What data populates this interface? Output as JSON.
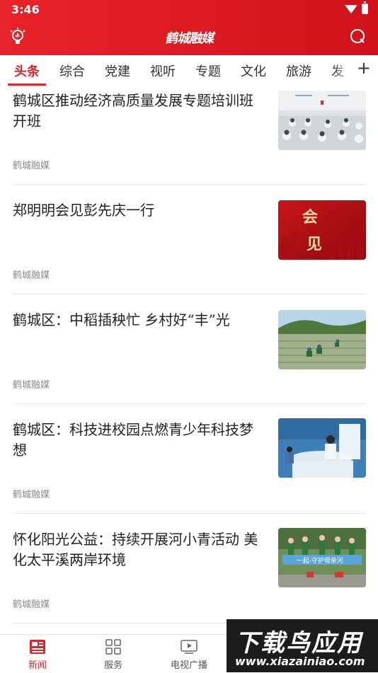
{
  "status": {
    "time": "3:46"
  },
  "app": {
    "title": "鹤城融媒"
  },
  "tabs": [
    "头条",
    "综合",
    "党建",
    "视听",
    "专题",
    "文化",
    "旅游",
    "发"
  ],
  "tabs_more": "+",
  "news": [
    {
      "title": "鹤城区推动经济高质量发展专题培训班开班",
      "source": "鹤城融媒"
    },
    {
      "title": "郑明明会见彭先庆一行",
      "source": "鹤城融媒",
      "badge": [
        "会",
        "见"
      ]
    },
    {
      "title": "鹤城区：中稻插秧忙 乡村好“丰”光",
      "source": "鹤城融媒"
    },
    {
      "title": "鹤城区：科技进校园点燃青少年科技梦想",
      "source": "鹤城融媒"
    },
    {
      "title": "怀化阳光公益：持续开展河小青活动 美化太平溪两岸环境",
      "source": "鹤城融媒",
      "banner": "一起·守护母亲河"
    }
  ],
  "nav": [
    {
      "label": "新闻",
      "icon": "news-icon"
    },
    {
      "label": "服务",
      "icon": "grid-icon"
    },
    {
      "label": "电视广播",
      "icon": "tv-icon"
    }
  ],
  "watermark": {
    "line1": "下载鸟应用",
    "line2": "www.xiazainiao.com"
  },
  "colors": {
    "brand": "#e0242b",
    "header": "#e8232a"
  }
}
